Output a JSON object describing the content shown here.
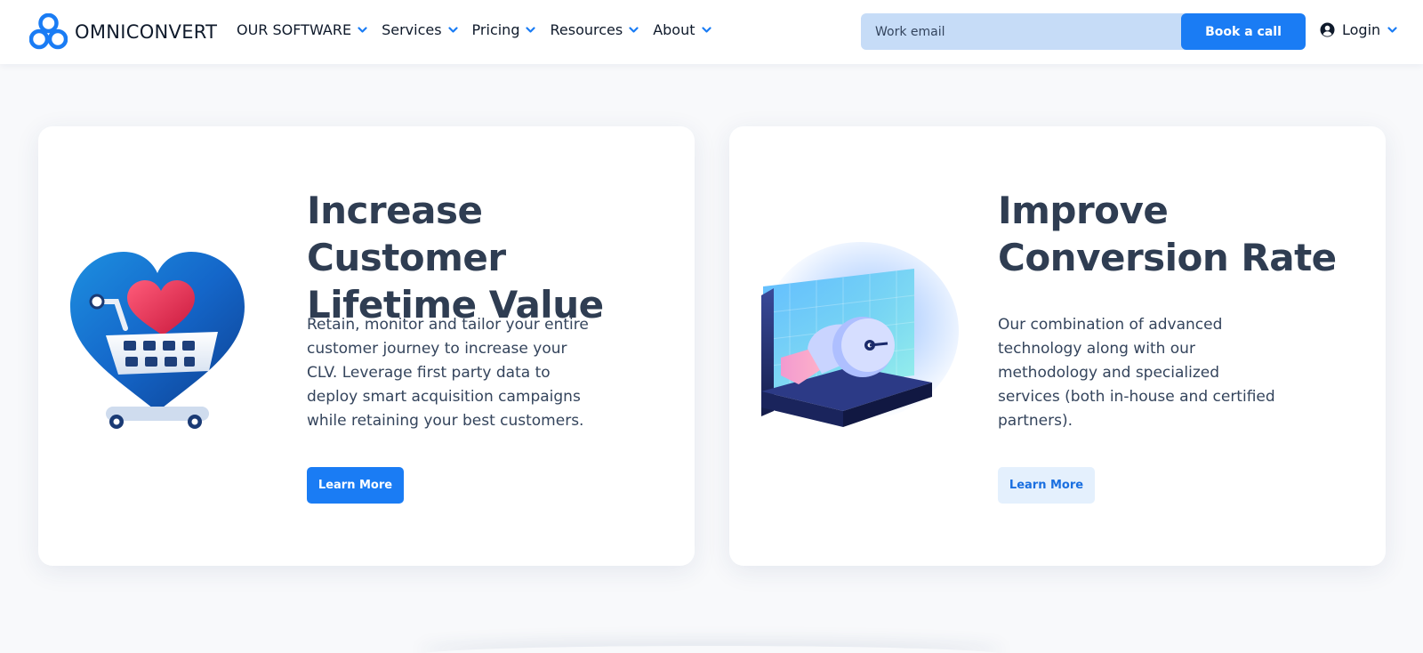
{
  "header": {
    "brand": "OMNICONVERT",
    "nav": [
      {
        "label": "OUR SOFTWARE"
      },
      {
        "label": "Services"
      },
      {
        "label": "Pricing"
      },
      {
        "label": "Resources"
      },
      {
        "label": "About"
      }
    ],
    "email_placeholder": "Work email",
    "book_label": "Book a call",
    "login_label": "Login"
  },
  "cards": [
    {
      "title": "Increase Customer Lifetime Value",
      "description": "Retain, monitor and tailor your entire customer journey to increase your CLV. Leverage first party data to deploy smart acquisition campaigns while retaining your best customers.",
      "button": "Learn More",
      "illustration": "heart-cart-icon"
    },
    {
      "title": "Improve Conversion Rate",
      "description": "Our combination of advanced technology along with our methodology and specialized services (both in-house and certified partners).",
      "button": "Learn More",
      "illustration": "conversion-machine-icon"
    }
  ],
  "colors": {
    "accent": "#1a7cf4",
    "accent_light": "#e4f0fd",
    "email_bg": "#c6dcf7",
    "title": "#2f3d52",
    "page_bg": "#f8f9fb"
  }
}
